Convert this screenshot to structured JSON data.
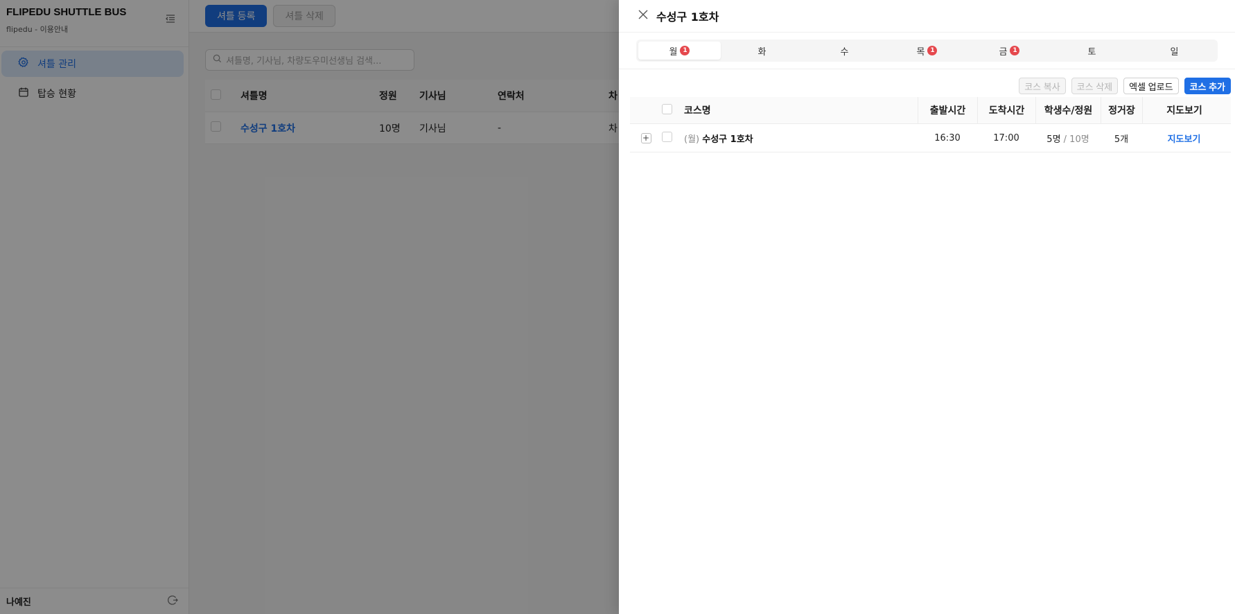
{
  "app": {
    "brand_title": "FLIPEDU SHUTTLE BUS",
    "brand_sub": "flipedu - 이용안내"
  },
  "sidebar": {
    "items": [
      {
        "label": "셔틀 관리",
        "icon": "gear-icon",
        "active": true
      },
      {
        "label": "탑승 현황",
        "icon": "calendar-icon",
        "active": false
      }
    ],
    "user_name": "나예진"
  },
  "main": {
    "register_button": "셔틀 등록",
    "delete_button": "셔틀 삭제",
    "search_placeholder": "셔틀명, 기사님, 차량도우미선생님 검색...",
    "table": {
      "headers": [
        "셔틀명",
        "정원",
        "기사님",
        "연락처",
        "차"
      ],
      "rows": [
        {
          "name": "수성구 1호차",
          "capacity": "10명",
          "driver": "기사님",
          "contact": "-",
          "extra": "차"
        }
      ]
    }
  },
  "drawer": {
    "title": "수성구 1호차",
    "days": [
      {
        "label": "월",
        "badge": "1",
        "active": true
      },
      {
        "label": "화",
        "badge": "",
        "active": false
      },
      {
        "label": "수",
        "badge": "",
        "active": false
      },
      {
        "label": "목",
        "badge": "1",
        "active": false
      },
      {
        "label": "금",
        "badge": "1",
        "active": false
      },
      {
        "label": "토",
        "badge": "",
        "active": false
      },
      {
        "label": "일",
        "badge": "",
        "active": false
      }
    ],
    "actions": {
      "copy": "코스 복사",
      "delete": "코스 삭제",
      "excel": "엑셀 업로드",
      "add": "코스 추가"
    },
    "table": {
      "headers": {
        "name": "코스명",
        "departure": "출발시간",
        "arrival": "도착시간",
        "students": "학생수/정원",
        "stops": "정거장",
        "map": "지도보기"
      },
      "rows": [
        {
          "day_prefix": "(월)",
          "name": "수성구 1호차",
          "departure": "16:30",
          "arrival": "17:00",
          "students": "5명",
          "capacity": "/ 10명",
          "stops": "5개",
          "map": "지도보기"
        }
      ]
    }
  }
}
